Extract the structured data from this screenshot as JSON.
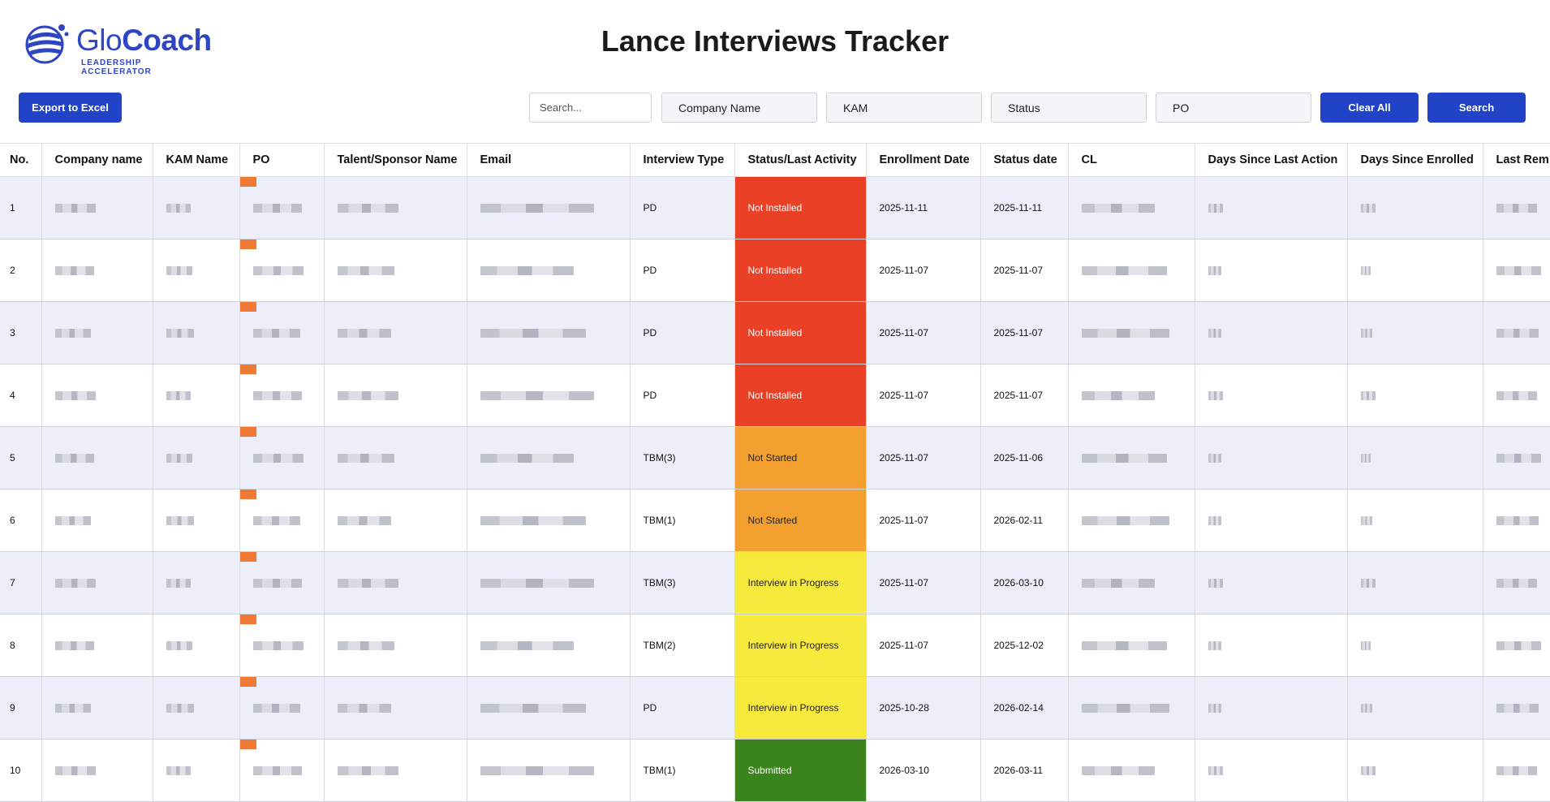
{
  "header": {
    "logo_main": "Glo",
    "logo_bold": "Coach",
    "logo_sub": "LEADERSHIP ACCELERATOR",
    "title": "Lance Interviews Tracker"
  },
  "toolbar": {
    "export_label": "Export to Excel",
    "search_placeholder": "Search...",
    "company_value": "Company Name",
    "kam_value": "KAM",
    "status_value": "Status",
    "po_value": "PO",
    "clear_label": "Clear All",
    "search_label": "Search"
  },
  "columns": [
    "No.",
    "Company name",
    "KAM Name",
    "PO",
    "Talent/Sponsor Name",
    "Email",
    "Interview Type",
    "Status/Last Activity",
    "Enrollment Date",
    "Status date",
    "CL",
    "Days Since Last Action",
    "Days Since Enrolled",
    "Last Rem"
  ],
  "rows": [
    {
      "no": "1",
      "type": "PD",
      "status": "Not Installed",
      "enrolled": "2025-11-11",
      "status_date": "2025-11-11"
    },
    {
      "no": "2",
      "type": "PD",
      "status": "Not Installed",
      "enrolled": "2025-11-07",
      "status_date": "2025-11-07"
    },
    {
      "no": "3",
      "type": "PD",
      "status": "Not Installed",
      "enrolled": "2025-11-07",
      "status_date": "2025-11-07"
    },
    {
      "no": "4",
      "type": "PD",
      "status": "Not Installed",
      "enrolled": "2025-11-07",
      "status_date": "2025-11-07"
    },
    {
      "no": "5",
      "type": "TBM(3)",
      "status": "Not Started",
      "enrolled": "2025-11-07",
      "status_date": "2025-11-06"
    },
    {
      "no": "6",
      "type": "TBM(1)",
      "status": "Not Started",
      "enrolled": "2025-11-07",
      "status_date": "2026-02-11"
    },
    {
      "no": "7",
      "type": "TBM(3)",
      "status": "Interview in Progress",
      "enrolled": "2025-11-07",
      "status_date": "2026-03-10"
    },
    {
      "no": "8",
      "type": "TBM(2)",
      "status": "Interview in Progress",
      "enrolled": "2025-11-07",
      "status_date": "2025-12-02"
    },
    {
      "no": "9",
      "type": "PD",
      "status": "Interview in Progress",
      "enrolled": "2025-10-28",
      "status_date": "2026-02-14"
    },
    {
      "no": "10",
      "type": "TBM(1)",
      "status": "Submitted",
      "enrolled": "2026-03-10",
      "status_date": "2026-03-11"
    }
  ],
  "status_colors": {
    "Not Installed": "#ea4126",
    "Not Started": "#f4a030",
    "Interview in Progress": "#f8ea3c",
    "Submitted": "#3a841e"
  }
}
